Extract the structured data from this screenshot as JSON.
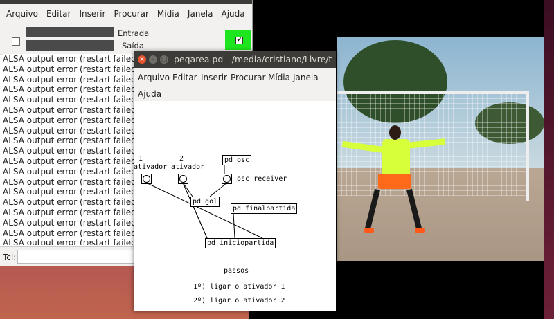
{
  "main_window": {
    "menu": [
      "Arquivo",
      "Editar",
      "Inserir",
      "Procurar",
      "Mídia",
      "Janela",
      "Ajuda"
    ],
    "meters": {
      "input_label": "Entrada",
      "output_label": "Saída"
    },
    "dsp_checked": true,
    "console_lines": [
      "ALSA output error (restart failed): Input/output error",
      "ALSA output error (restart failed): Input/output error",
      "ALSA output error (restart failed): Input/output error",
      "ALSA output error (restart failed): Input/output error",
      "ALSA output error (restart failed): Input/output error",
      "ALSA output error (restart failed): Input/output error",
      "ALSA output error (restart failed): Input/output error",
      "ALSA output error (restart failed): Input/output error",
      "ALSA output error (restart failed): Input/output error",
      "ALSA output error (restart failed): Input/output error",
      "ALSA output error (restart failed): Input/output error",
      "ALSA output error (restart failed): Input/output error",
      "ALSA output error (restart failed): Input/output error",
      "ALSA output error (restart failed): Input/output error",
      "ALSA output error (restart failed): Input/output error",
      "ALSA output error (restart failed): Input/output error",
      "ALSA output error (restart failed): Input/output error",
      "ALSA output error (restart failed): Input/output error",
      "ALSA output error (restart failed): Input/output error"
    ],
    "tcl_label": "Tcl:"
  },
  "patch_window": {
    "title": "peqarea.pd  - /media/cristiano/Livre/t",
    "menu": [
      "Arquivo",
      "Editar",
      "Inserir",
      "Procurar",
      "Mídia",
      "Janela",
      "Ajuda"
    ],
    "comments": {
      "num1": "1",
      "num2": "2",
      "ativador1": "ativador",
      "ativador2": "ativador",
      "osc_receiver": "osc receiver",
      "passos": "passos",
      "step1": "1º) ligar o ativador 1",
      "step2": "2º) ligar o ativador 2"
    },
    "objects": {
      "pd_osc": "pd osc",
      "pd_gol": "pd gol",
      "pd_finalpartida": "pd finalpartida",
      "pd_iniciopartida": "pd iniciopartida"
    }
  }
}
